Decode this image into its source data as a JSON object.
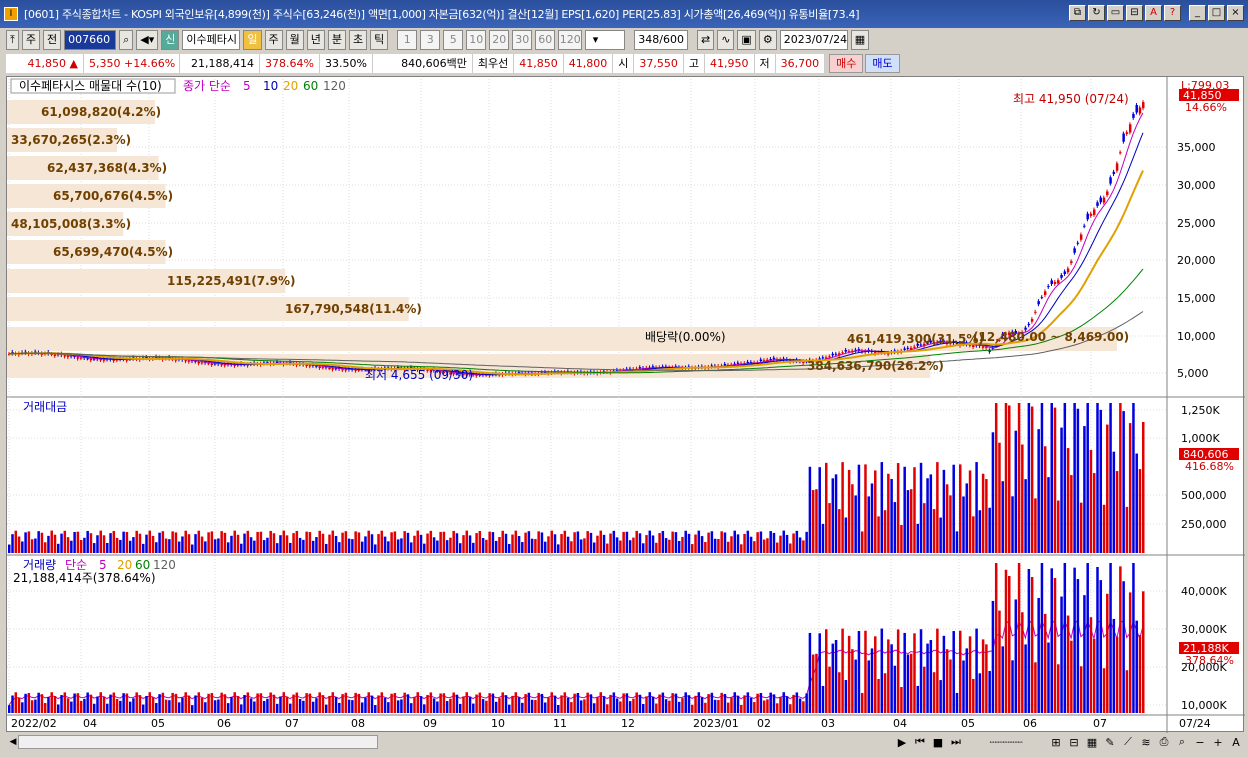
{
  "title": "[0601] 주식종합차트 - KOSPI 외국인보유[4,899(천)] 주식수[63,246(천)] 액면[1,000] 자본금[632(억)] 결산[12월] EPS[1,620] PER[25.83] 시가총액[26,469(억)] 유통비율[73.4]",
  "toolbar": {
    "market": "주",
    "prev": "전",
    "code": "007660",
    "stock_name": "이수페타시",
    "periods": [
      "일",
      "주",
      "월",
      "년",
      "분",
      "초",
      "틱"
    ],
    "nums": [
      "1",
      "3",
      "5",
      "10",
      "20",
      "30",
      "60",
      "120"
    ],
    "count": "348",
    "count_total": "/600",
    "date": "2023/07/24"
  },
  "quote": {
    "price": "41,850",
    "change": "5,350",
    "pct": "+14.66%",
    "volume": "21,188,414",
    "vol_ratio": "378.64%",
    "turnover": "33.50%",
    "amount": "840,606백만",
    "best_label": "최우선",
    "ask": "41,850",
    "bid": "41,800",
    "open_label": "시",
    "open": "37,550",
    "high_label": "고",
    "high": "41,950",
    "low_label": "저",
    "low": "36,700",
    "buy": "매수",
    "sell": "매도"
  },
  "price_panel": {
    "legend_title": "이수페타시스 매물대 수(10)",
    "ma_label": "종가 단순",
    "ma": [
      "5",
      "10",
      "20",
      "60",
      "120"
    ],
    "ma_colors": [
      "#c000c0",
      "#0000c0",
      "#e0a000",
      "#008000",
      "#606060"
    ],
    "profile": [
      {
        "label": "61,098,820(4.2%)",
        "pct": 4.2
      },
      {
        "label": "33,670,265(2.3%)",
        "pct": 2.3
      },
      {
        "label": "62,437,368(4.3%)",
        "pct": 4.3
      },
      {
        "label": "65,700,676(4.5%)",
        "pct": 4.5
      },
      {
        "label": "48,105,008(3.3%)",
        "pct": 3.3
      },
      {
        "label": "65,699,470(4.5%)",
        "pct": 4.5
      },
      {
        "label": "115,225,491(7.9%)",
        "pct": 7.9
      },
      {
        "label": "167,790,548(11.4%)",
        "pct": 11.4
      },
      {
        "label": "461,419,300(31.5%)",
        "pct": 31.5
      },
      {
        "label": "384,636,790(26.2%)",
        "pct": 26.2
      }
    ],
    "annot_high": "최고 41,950 (07/24)",
    "annot_low": "최저 4,655 (09/30)",
    "annot_div": "배당락(0.00%)",
    "annot_range": "(12,480.00 ~ 8,469.00)",
    "yticks": [
      "35,000",
      "30,000",
      "25,000",
      "20,000",
      "15,000",
      "10,000",
      "5,000"
    ],
    "top_label": "L:799.03",
    "price_tag": "41,850",
    "price_pct": "14.66%"
  },
  "amount_panel": {
    "title": "거래대금",
    "yticks": [
      "1,250,000",
      "1,000,000",
      "750,000",
      "500,000",
      "250,000"
    ],
    "yticks_short": [
      "1,250K",
      "1,000K",
      "",
      "500,000",
      "250,000"
    ],
    "tag": "840,606",
    "tag_pct": "416.68%"
  },
  "volume_panel": {
    "title": "거래량",
    "ma_label": "단순",
    "ma": [
      "5",
      "20",
      "60",
      "120"
    ],
    "sub": "21,188,414주(378.64%)",
    "yticks": [
      "40,000K",
      "30,000K",
      "20,000K",
      "10,000K"
    ],
    "tag": "21,188K",
    "tag_pct": "378.64%"
  },
  "xaxis": [
    "2022/02",
    "04",
    "05",
    "06",
    "07",
    "08",
    "09",
    "10",
    "11",
    "12",
    "2023/01",
    "02",
    "03",
    "04",
    "05",
    "06",
    "07",
    "07/24"
  ]
}
